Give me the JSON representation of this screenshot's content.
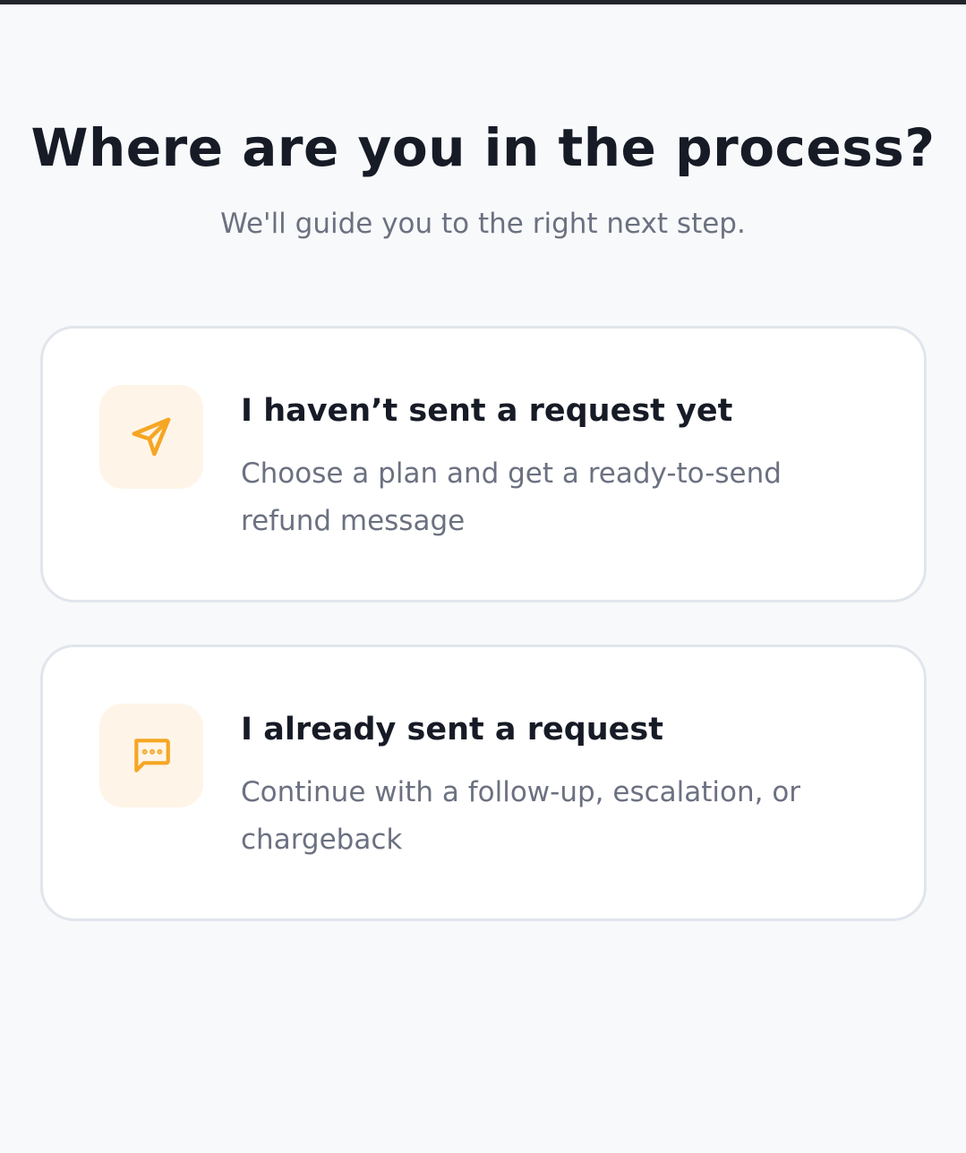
{
  "header": {
    "title": "Where are you in the process?",
    "subtitle": "We'll guide you to the right next step."
  },
  "options": [
    {
      "title": "I haven’t sent a request yet",
      "description": "Choose a plan and get a ready-to-send refund message",
      "icon": "send-icon"
    },
    {
      "title": "I already sent a request",
      "description": "Continue with a follow-up, escalation, or chargeback",
      "icon": "message-dots-icon"
    }
  ],
  "colors": {
    "accent": "#f5a623",
    "icon_background": "#fef5e8",
    "title": "#161b26",
    "muted_text": "#6b7180",
    "card_border": "#e1e5ec"
  }
}
